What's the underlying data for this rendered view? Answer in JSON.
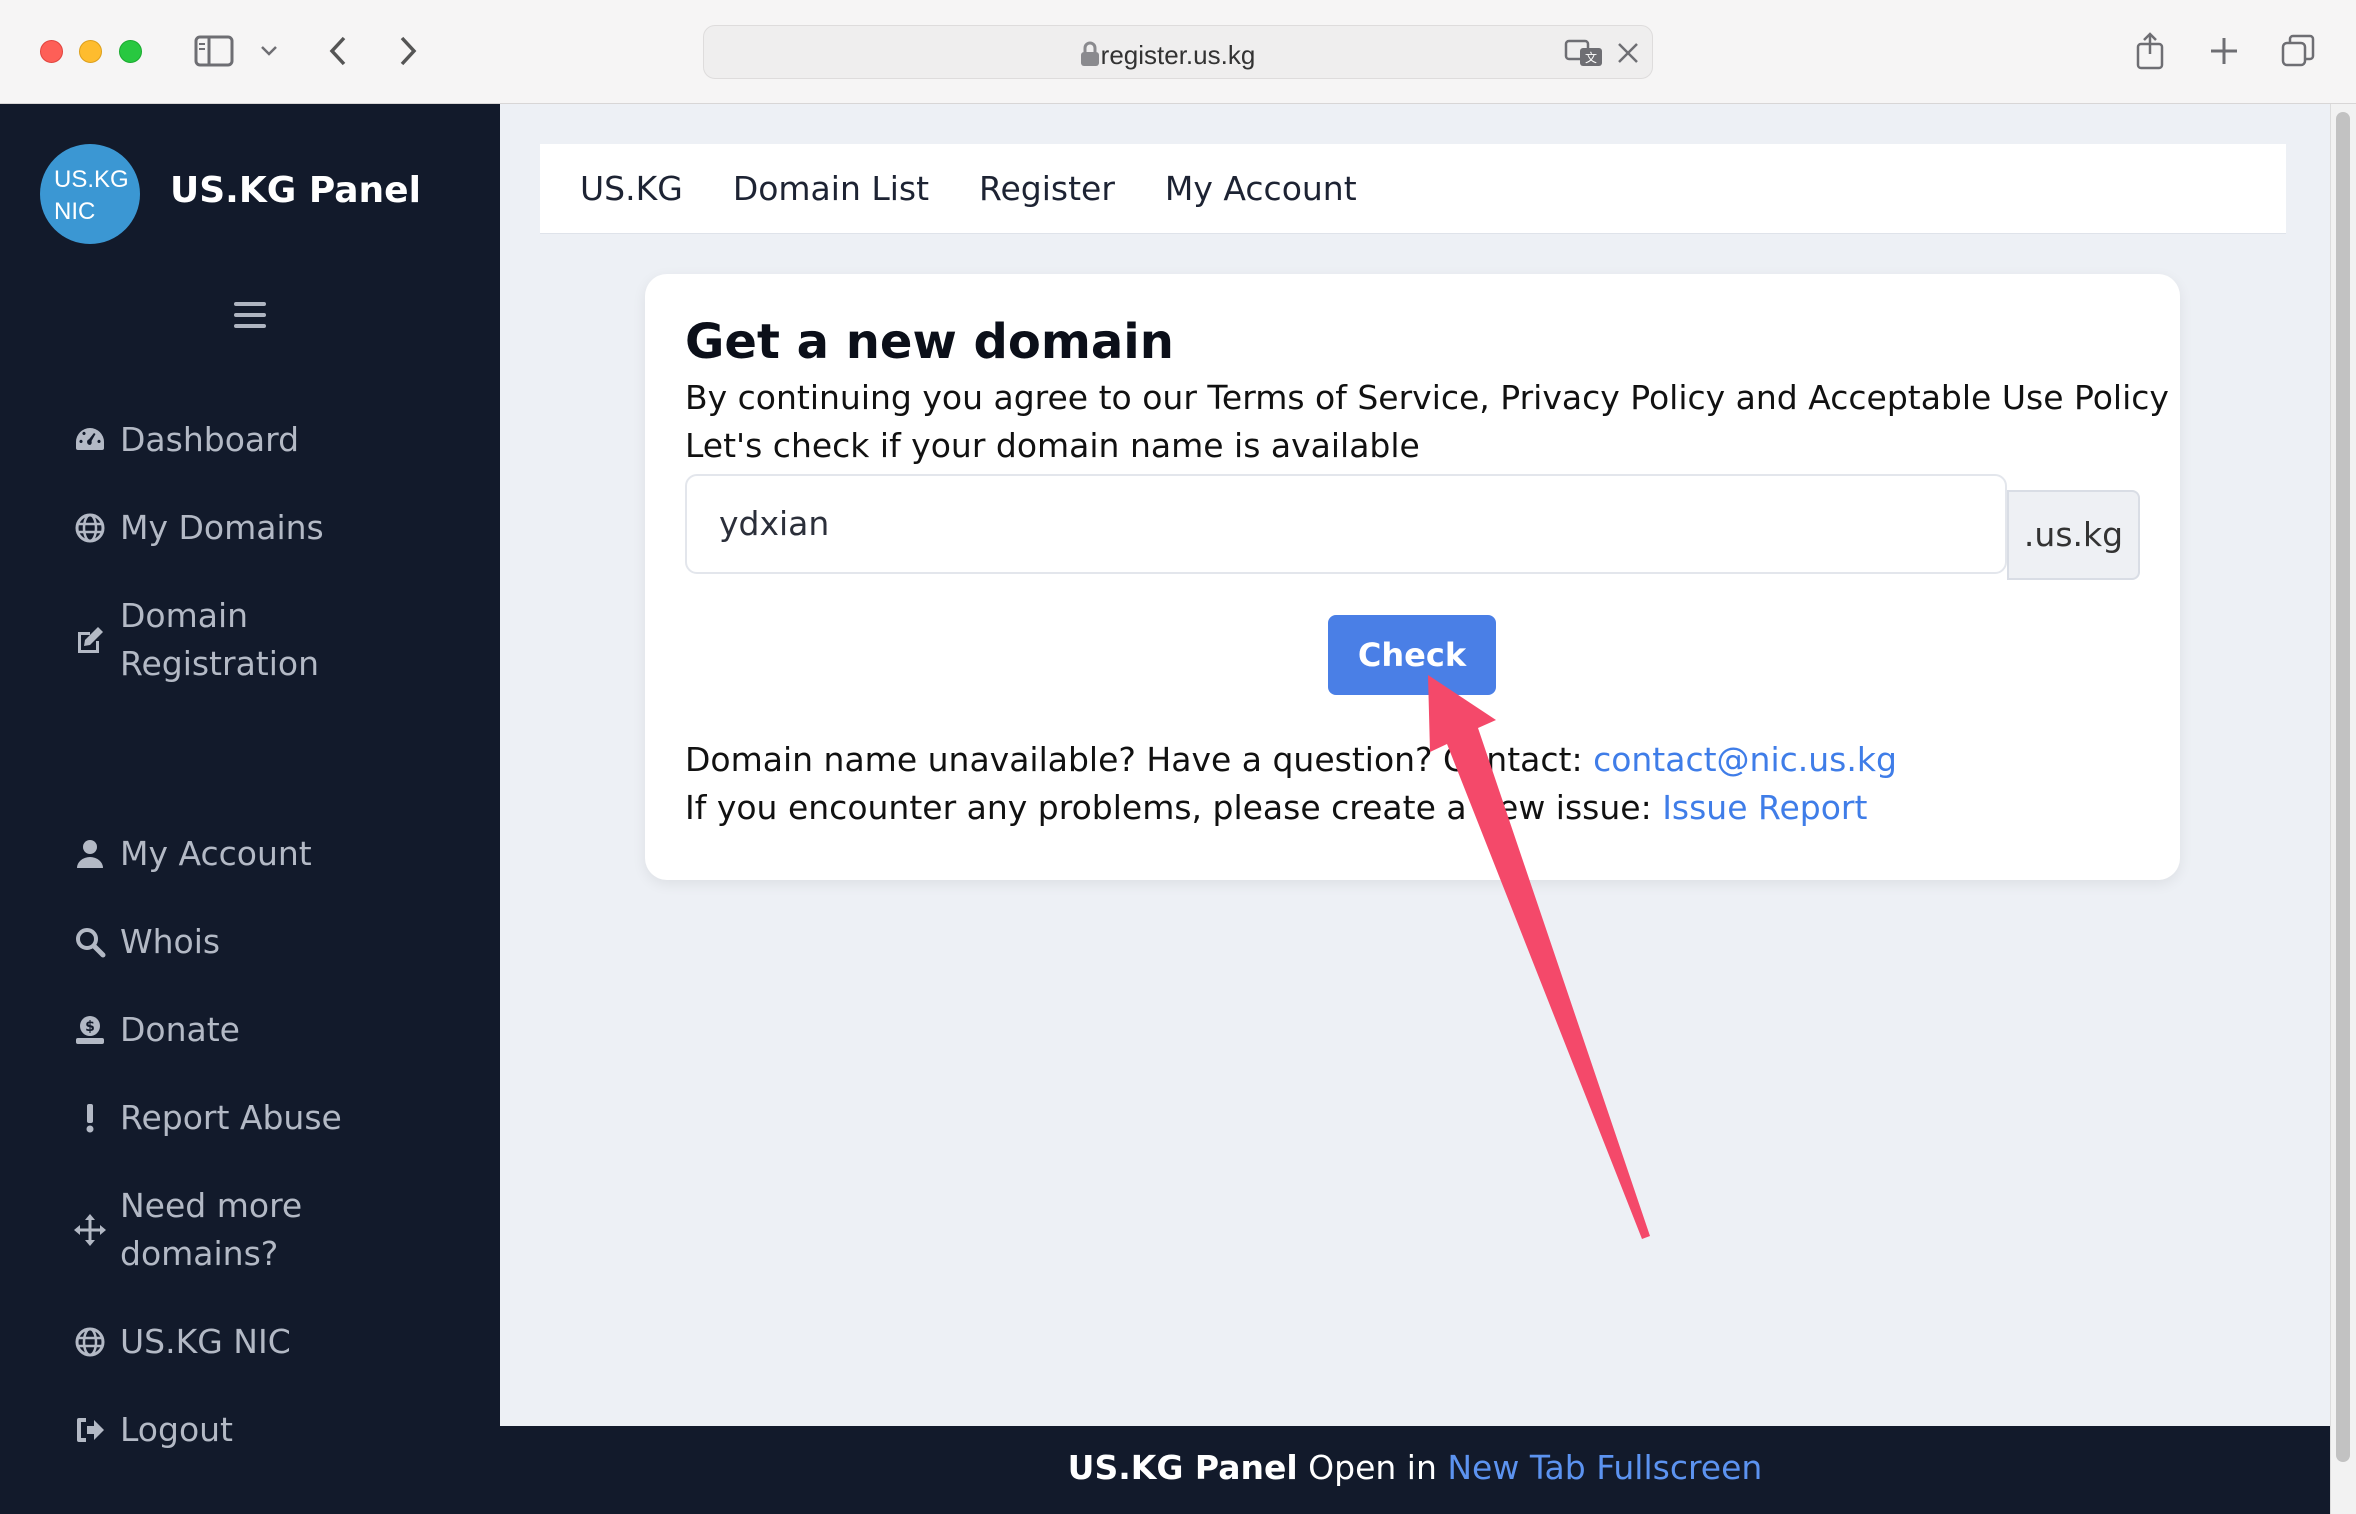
{
  "browser": {
    "url": "register.us.kg"
  },
  "sidebar": {
    "logo_line1": "US.KG",
    "logo_line2": "NIC",
    "brand": "US.KG Panel",
    "items": [
      {
        "label": "Dashboard",
        "icon": "gauge-icon"
      },
      {
        "label": "My Domains",
        "icon": "globe-icon"
      },
      {
        "label": "Domain",
        "label2": "Registration",
        "icon": "edit-icon"
      },
      {
        "label": "My Account",
        "icon": "user-icon"
      },
      {
        "label": "Whois",
        "icon": "search-icon"
      },
      {
        "label": "Donate",
        "icon": "donate-icon"
      },
      {
        "label": "Report Abuse",
        "icon": "exclamation-icon"
      },
      {
        "label": "Need more",
        "label2": "domains?",
        "icon": "move-icon"
      },
      {
        "label": "US.KG NIC",
        "icon": "globe-icon"
      },
      {
        "label": "Logout",
        "icon": "logout-icon"
      }
    ]
  },
  "topnav": {
    "links": [
      "US.KG",
      "Domain List",
      "Register",
      "My Account"
    ]
  },
  "card": {
    "title": "Get a new domain",
    "terms": "By continuing you agree to our Terms of Service, Privacy Policy and Acceptable Use Policy",
    "prompt": "Let's check if your domain name is available",
    "input_value": "ydxian",
    "suffix": ".us.kg",
    "check_label": "Check",
    "contact_text": "Domain name unavailable? Have a question? Contact: ",
    "contact_link": "contact@nic.us.kg",
    "issue_text": "If you encounter any problems, please create a new issue: ",
    "issue_link": "Issue Report"
  },
  "footer": {
    "brand": "US.KG Panel",
    "open_in": " Open in ",
    "link": "New Tab Fullscreen"
  },
  "colors": {
    "sidebar_bg": "#121a2b",
    "accent": "#4a7fe6",
    "link": "#3f7de8",
    "annotation_arrow": "#f4496a"
  }
}
